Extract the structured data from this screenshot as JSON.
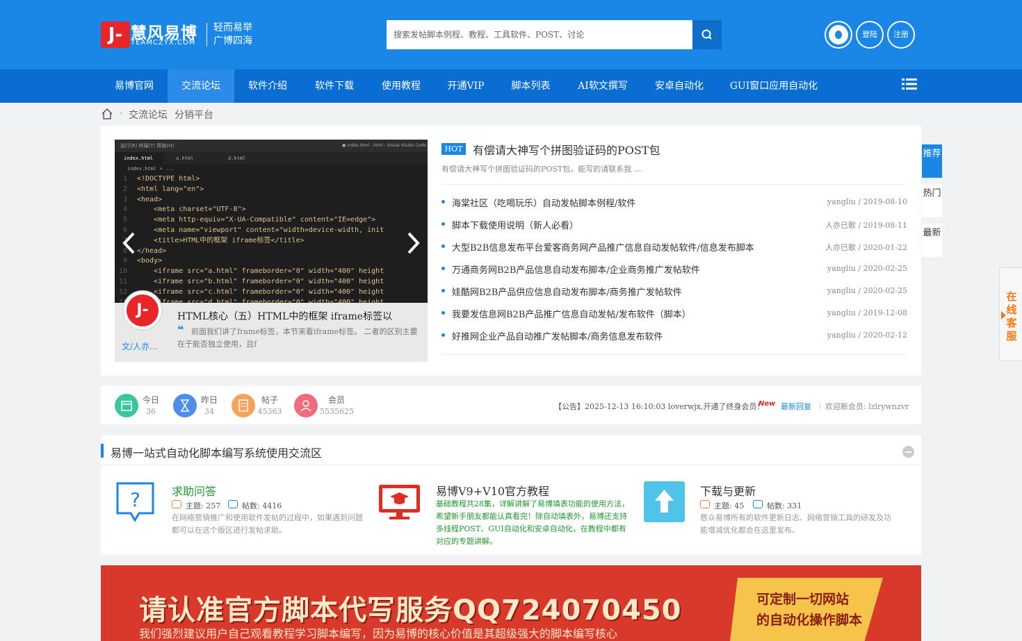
{
  "header": {
    "logo_glyph": "J-",
    "logo_text": "慧风易博",
    "logo_sub": "TEAMCZYX.COM",
    "slogan_1": "轻而易举",
    "slogan_2": "广博四海",
    "search_placeholder": "搜索发帖脚本例程、教程、工具软件、POST、讨论",
    "login": "登陆",
    "register": "注册"
  },
  "nav": [
    {
      "label": "易博官网"
    },
    {
      "label": "交流论坛"
    },
    {
      "label": "软件介绍"
    },
    {
      "label": "软件下载"
    },
    {
      "label": "使用教程"
    },
    {
      "label": "开通VIP"
    },
    {
      "label": "脚本列表"
    },
    {
      "label": "AI软文撰写"
    },
    {
      "label": "安卓自动化"
    },
    {
      "label": "GUI窗口应用自动化"
    }
  ],
  "breadcrumb": [
    "交流论坛",
    "分销平台"
  ],
  "slide": {
    "title": "HTML核心（五）HTML中的框架 iframe标签以",
    "excerpt": "前面我们讲了frame标签，本节来看iframe标签。 二者的区别主要在于能否独立使用，且f",
    "author": "文/人亦…",
    "editor_menu": "运行(R)   终端(T)   帮助(H)",
    "editor_title": "● index.html - html - Visual Studio Code",
    "tabs": [
      "index.html",
      "a.html",
      "d.html"
    ],
    "path": "index.html > ...",
    "lines": [
      "<!DOCTYPE html>",
      "<html lang=\"en\">",
      "<head>",
      "    <meta charset=\"UTF-8\">",
      "    <meta http-equiv=\"X-UA-Compatible\" content=\"IE=edge\">",
      "    <meta name=\"viewport\" content=\"width=device-width, init",
      "    <title>HTML中的框架 iframe标签</title>",
      "</head>",
      "<body>",
      "    <iframe src=\"a.html\" frameborder=\"0\" width=\"400\" height",
      "    <iframe src=\"b.html\" frameborder=\"0\" width=\"400\" height",
      "    <iframe src=\"c.html\" frameborder=\"0\" width=\"400\" height",
      "    <iframe src=\"d.html\" frameborder=\"0\" width=\"400\" height"
    ]
  },
  "hot": {
    "badge": "HOT",
    "title": "有偿请大神写个拼图验证码的POST包",
    "desc": "有偿请大神写个拼图验证码的POST包，能写的请联系我 ..."
  },
  "threads": [
    {
      "title": "海棠社区（吃喝玩乐）自动发帖脚本例程/软件",
      "meta": "yangliu / 2019-08-10"
    },
    {
      "title": "脚本下载使用说明（新人必看）",
      "meta": "人亦已歌 / 2019-08-11"
    },
    {
      "title": "大型B2B信息发布平台爱客商务网产品推广信息自动发帖软件/信息发布脚本",
      "meta": "人亦已歌 / 2020-01-22"
    },
    {
      "title": "万通商务网B2B产品信息自动发布脚本/企业商务推广发帖软件",
      "meta": "yangliu / 2020-02-25"
    },
    {
      "title": "娃酷网B2B产品供应信息自动发布脚本/商务推广发帖软件",
      "meta": "yangliu / 2020-02-25"
    },
    {
      "title": "我要发信息网B2B产品推广信息自动发帖/发布软件（脚本）",
      "meta": "yangliu / 2019-12-08"
    },
    {
      "title": "好推网企业产品自动推广发帖脚本/商务信息发布软件",
      "meta": "yangliu / 2020-02-12"
    }
  ],
  "side_tabs": [
    {
      "label": "推荐"
    },
    {
      "label": "热门"
    },
    {
      "label": "最新"
    }
  ],
  "kefu": "在线客服",
  "stats": [
    {
      "label": "今日",
      "value": "36",
      "color": "#3ac7a0"
    },
    {
      "label": "昨日",
      "value": "34",
      "color": "#4b8fe8"
    },
    {
      "label": "帖子",
      "value": "45363",
      "color": "#f5a35a"
    },
    {
      "label": "会员",
      "value": "5535625",
      "color": "#f06b7b"
    }
  ],
  "notice": {
    "text": "【公告】2025-12-13 16:10:03 loverwjx,开通了终身会员！",
    "new_badge": "New",
    "latest": "最新回复",
    "welcome": "欢迎新会员: lzlrywnzvr"
  },
  "section": {
    "title": "易博一站式自动化脚本编写系统使用交流区",
    "forums": [
      {
        "name": "求助问答",
        "topics": "主题: 257",
        "posts": "帖数: 4416",
        "desc": "在网络营销推广和使用软件发帖的过程中，如果遇到问题都可以在这个版区进行发帖求助。",
        "name_color": "#1f9a2e"
      },
      {
        "name": "易博V9+V10官方教程",
        "topics": "",
        "posts": "",
        "desc": "基础教程共28集，详解讲解了易博填表功能的使用方法，希望新手朋友都能认真看完！除自动填表外，易博还支持多线程POST、GUI自动化和安卓自动化，在教程中都有对应的专题讲解。",
        "name_color": "#333333"
      },
      {
        "name": "下载与更新",
        "topics": "主题: 45",
        "posts": "帖数: 331",
        "desc": "慈众易博所有的软件更新日志、网络营销工具的研发及功能增减优化都会在这里发布。",
        "name_color": "#333333"
      }
    ]
  },
  "banner": {
    "headline": "请认准官方脚本代写服务QQ724070450",
    "sub": "我们强烈建议用户自己观看教程学习脚本编写，因为易博的核心价值是其超级强大的脚本编写核心",
    "tag_1": "可定制一切网站",
    "tag_2": "的自动化操作脚本"
  },
  "colors": {
    "primary": "#1a87e6",
    "nav": "#0a6dd2",
    "accent_red": "#e8262a"
  }
}
